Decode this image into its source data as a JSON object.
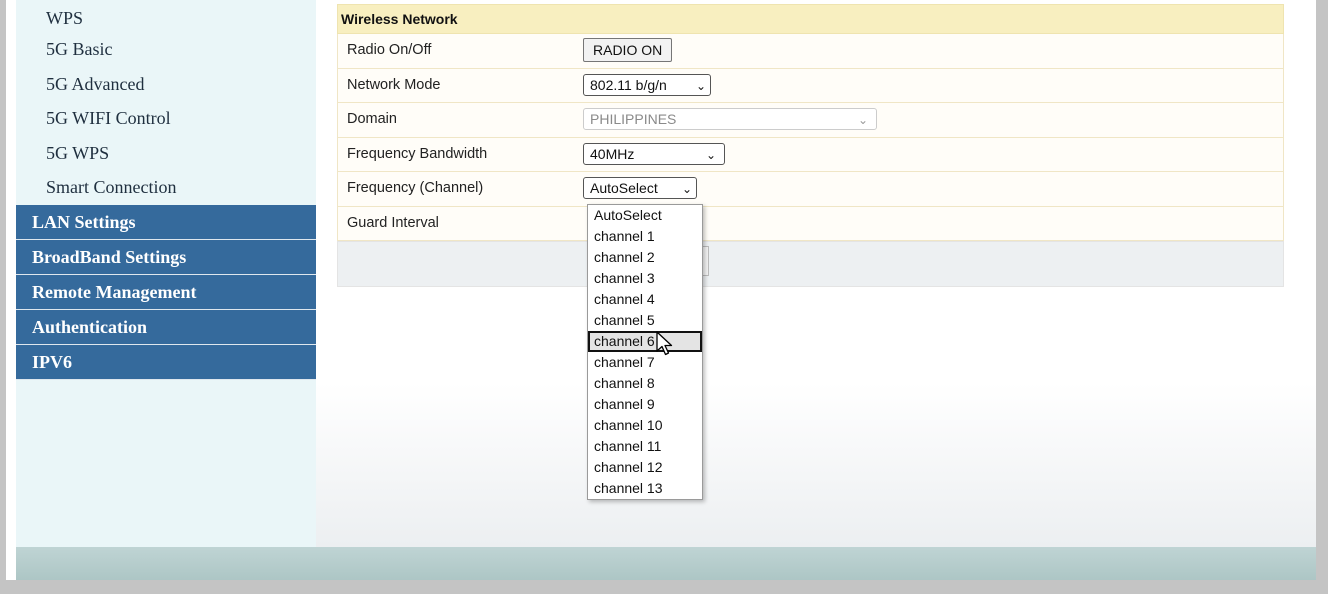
{
  "sidebar": {
    "sub_items": [
      {
        "label": "WPS"
      },
      {
        "label": "5G Basic"
      },
      {
        "label": "5G Advanced"
      },
      {
        "label": "5G WIFI Control"
      },
      {
        "label": "5G WPS"
      },
      {
        "label": "Smart Connection"
      }
    ],
    "main_items": [
      {
        "label": "LAN Settings"
      },
      {
        "label": "BroadBand Settings"
      },
      {
        "label": "Remote Management"
      },
      {
        "label": "Authentication"
      },
      {
        "label": "IPV6"
      }
    ]
  },
  "panel": {
    "title": "Wireless Network",
    "rows": {
      "radio": {
        "label": "Radio On/Off",
        "button": "RADIO ON"
      },
      "mode": {
        "label": "Network Mode",
        "value": "802.11 b/g/n"
      },
      "domain": {
        "label": "Domain",
        "value": "PHILIPPINES"
      },
      "bandwidth": {
        "label": "Frequency Bandwidth",
        "value": "40MHz"
      },
      "channel": {
        "label": "Frequency (Channel)",
        "value": "AutoSelect"
      },
      "guard": {
        "label": "Guard Interval"
      }
    }
  },
  "channel_dropdown": {
    "options": [
      "AutoSelect",
      "channel 1",
      "channel 2",
      "channel 3",
      "channel 4",
      "channel 5",
      "channel 6",
      "channel 7",
      "channel 8",
      "channel 9",
      "channel 10",
      "channel 11",
      "channel 12",
      "channel 13"
    ],
    "hovered_index": 6
  },
  "icons": {
    "cursor": "arrow-pointer-icon",
    "chevron": "chevron-down-icon"
  },
  "colors": {
    "nav_blue": "#356a9c",
    "panel_header": "#f8efc0",
    "footer": "#b4cbca"
  }
}
